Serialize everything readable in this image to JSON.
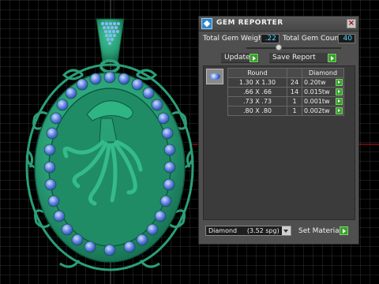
{
  "panel": {
    "title": "GEM REPORTER",
    "total_gem_weight_label": "Total Gem Weight",
    "total_gem_weight_value": ".22",
    "total_gem_count_label": "Total Gem Count",
    "total_gem_count_value": "40",
    "update_label": "Update",
    "save_report_label": "Save Report",
    "table": {
      "headers": [
        "Round",
        "",
        "Diamond"
      ],
      "rows": [
        {
          "size": "1.30 X 1.30",
          "count": "24",
          "weight": "0.20tw"
        },
        {
          "size": ".66 X .66",
          "count": "14",
          "weight": "0.015tw"
        },
        {
          "size": ".73 X .73",
          "count": "1",
          "weight": "0.001tw"
        },
        {
          "size": ".80 X .80",
          "count": "1",
          "weight": "0.002tw"
        }
      ]
    },
    "material_select_value": "Diamond     (3.52 spg)",
    "set_material_label": "Set Material"
  },
  "colors": {
    "metal": "#2aa077",
    "metal_dark": "#0d5b40",
    "gem": "#5f7fe0",
    "grid": "#4a4a4a",
    "axis_red": "#c01818",
    "value_text": "#4fd7ff"
  }
}
